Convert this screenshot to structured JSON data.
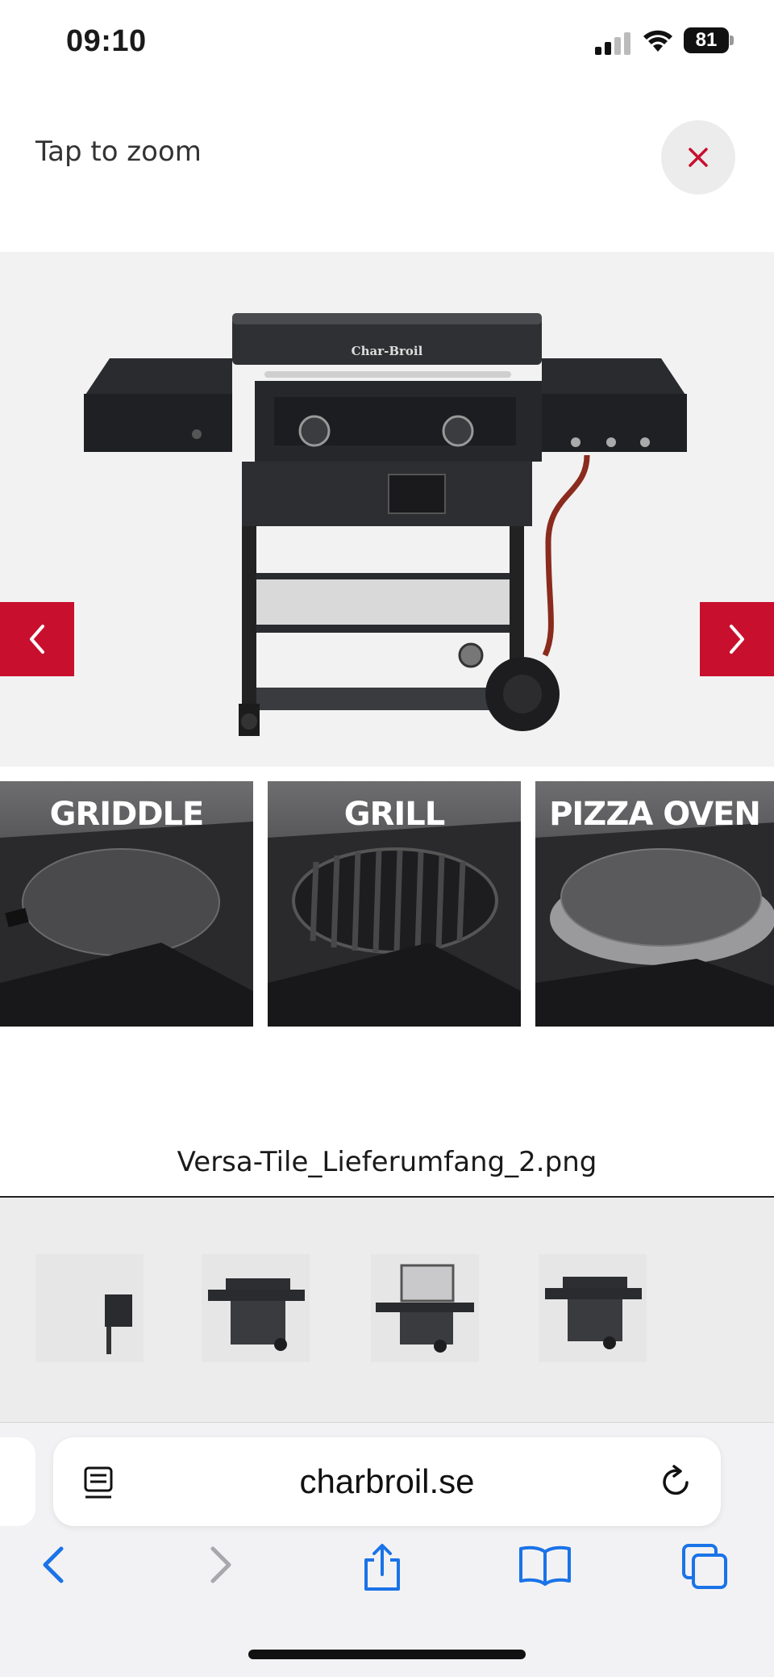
{
  "status_bar": {
    "time": "09:10",
    "battery": "81"
  },
  "viewer": {
    "hint": "Tap to zoom",
    "close_icon": "close-icon",
    "prev_icon": "chevron-left-icon",
    "next_icon": "chevron-right-icon",
    "brand_on_product": "Char-Broil",
    "tiles": [
      {
        "label": "GRIDDLE"
      },
      {
        "label": "GRILL"
      },
      {
        "label": "PIZZA OVEN"
      }
    ],
    "filename": "Versa-Tile_Lieferumfang_2.png"
  },
  "thumbnails": {
    "count_visible": 4
  },
  "browser": {
    "url": "charbroil.se",
    "toolbar": [
      "back-icon",
      "forward-icon",
      "share-icon",
      "bookmarks-icon",
      "tabs-icon"
    ]
  },
  "colors": {
    "accent": "#c8102e",
    "toolbar_blue": "#1a73e8"
  }
}
